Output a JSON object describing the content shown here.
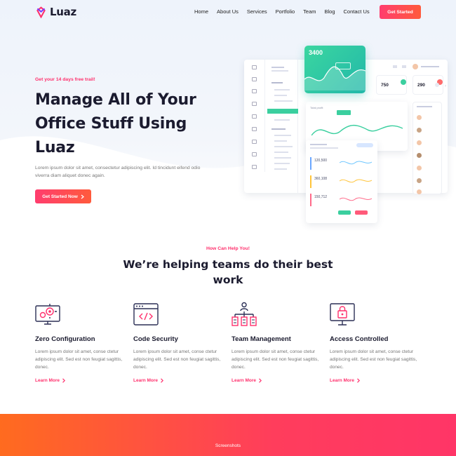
{
  "brand": {
    "name": "Luaz",
    "accent": "#ff2f6c",
    "gradient": [
      "#ff6b1f",
      "#ff3567"
    ]
  },
  "nav": {
    "items": [
      "Home",
      "About Us",
      "Services",
      "Portfolio",
      "Team",
      "Blog",
      "Contact Us"
    ],
    "cta": "Get Started"
  },
  "hero": {
    "kicker": "Get your 14 days free trail!",
    "title": "Manage All of Your Office Stuff Using Luaz",
    "description": "Lorem ipsum dolor sit amet, consectetur adipiscing elit. Id tincidunt eifend odio viverra diam aliquet donec again.",
    "cta": "Get Started Now"
  },
  "dashboard": {
    "green_card_value": "3400",
    "stat_1": "750",
    "stat_2": "290",
    "chart_card_title": "Total profit",
    "list_rows": [
      "120,500",
      "360,108",
      "150,712"
    ]
  },
  "services": {
    "kicker": "How Can Help You!",
    "title": "We’re helping teams do their best work",
    "items": [
      {
        "title": "Zero Configuration",
        "icon": "monitor-gears-icon",
        "desc": "Lorem ipsum dolor sit amet, conse ctetur adipiscing elit. Sed est non feugiat sagittis, donec.",
        "link": "Learn More"
      },
      {
        "title": "Code Security",
        "icon": "browser-code-icon",
        "desc": "Lorem ipsum dolor sit amet, conse ctetur adipiscing elit. Sed est non feugiat sagittis, donec.",
        "link": "Learn More"
      },
      {
        "title": "Team Management",
        "icon": "org-chart-icon",
        "desc": "Lorem ipsum dolor sit amet, conse ctetur adipiscing elit. Sed est non feugiat sagittis, donec.",
        "link": "Learn More"
      },
      {
        "title": "Access Controlled",
        "icon": "monitor-lock-icon",
        "desc": "Lorem ipsum dolor sit amet, conse ctetur adipiscing elit. Sed est non feugiat sagittis, donec.",
        "link": "Learn More"
      }
    ]
  },
  "screenshots": {
    "kicker": "Screenshots"
  }
}
